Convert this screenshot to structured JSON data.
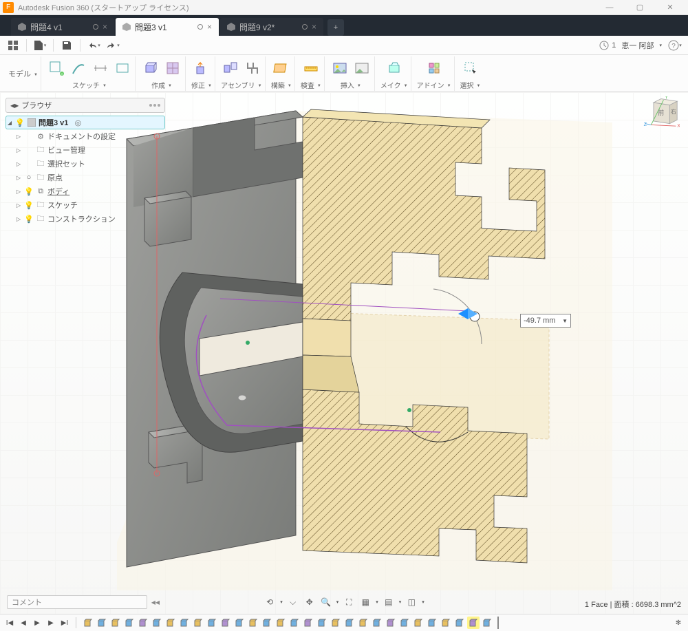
{
  "title": "Autodesk Fusion 360 (スタートアップ ライセンス)",
  "tabs": [
    {
      "label": "問題4 v1",
      "active": false
    },
    {
      "label": "問題3 v1",
      "active": true
    },
    {
      "label": "問題9 v2*",
      "active": false
    }
  ],
  "qat": {
    "version_count": "1",
    "user": "恵一 阿部"
  },
  "ribbon": {
    "workspace": "モデル",
    "groups": [
      {
        "label": "スケッチ"
      },
      {
        "label": "作成"
      },
      {
        "label": "修正"
      },
      {
        "label": "アセンブリ"
      },
      {
        "label": "構築"
      },
      {
        "label": "検査"
      },
      {
        "label": "挿入"
      },
      {
        "label": "メイク"
      },
      {
        "label": "アドイン"
      },
      {
        "label": "選択"
      }
    ]
  },
  "browser": {
    "title": "ブラウザ",
    "root": "問題3 v1",
    "items": [
      {
        "label": "ドキュメントの設定",
        "bulb": false,
        "icon": "gear"
      },
      {
        "label": "ビュー管理",
        "bulb": false,
        "icon": "folder"
      },
      {
        "label": "選択セット",
        "bulb": false,
        "icon": "folder"
      },
      {
        "label": "原点",
        "bulb": true,
        "icon": "folder",
        "bulb_on": false
      },
      {
        "label": "ボディ",
        "bulb": true,
        "icon": "bodies",
        "bulb_on": true,
        "underline": true
      },
      {
        "label": "スケッチ",
        "bulb": true,
        "icon": "folder",
        "bulb_on": true
      },
      {
        "label": "コンストラクション",
        "bulb": true,
        "icon": "folder",
        "bulb_on": true
      }
    ]
  },
  "dimension": {
    "value": "-49.7 mm"
  },
  "viewcube": {
    "front": "前",
    "right": "右",
    "axes": {
      "x": "X",
      "y": "Y",
      "z": "Z"
    }
  },
  "comment_label": "コメント",
  "status": "1 Face | 面積 : 6698.3 mm^2",
  "timeline": {
    "items": 30,
    "active_index": 28
  }
}
